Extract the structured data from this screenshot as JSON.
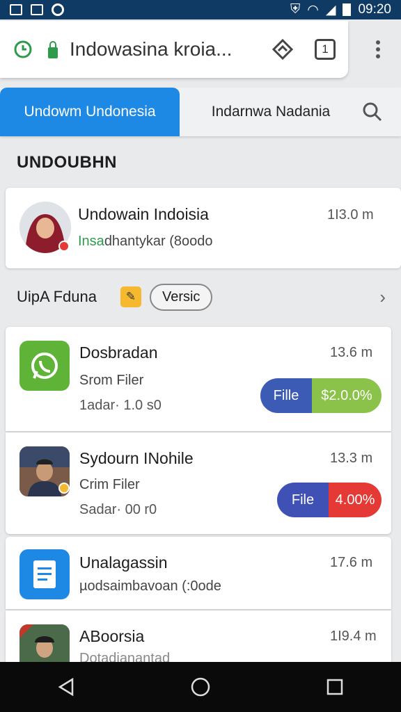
{
  "status_bar": {
    "time": "09:20"
  },
  "browser": {
    "url_text": "Indowasina kroia...",
    "tab_count": "1"
  },
  "tabs": [
    {
      "label": "Undowm Undonesia"
    },
    {
      "label": "Indarnwa Nadania"
    }
  ],
  "section_title": "UNDOUBHN",
  "profile": {
    "name": "Undowain Indoisia",
    "subtitle_green": "Insa",
    "subtitle_rest": "dhantykar (8oodo",
    "time": "1I3.0 m"
  },
  "filter": {
    "label": "UipA Fduna",
    "chip": "Versic"
  },
  "items": [
    {
      "title": "Dosbradan",
      "sub": "Srom Filer",
      "meta": "1adar· 1.0 s0",
      "time": "13.6 m",
      "pill_left": "Fille",
      "pill_right": "$2.0.0%",
      "pill_left_color": "#3b5bb5",
      "pill_right_color": "#8bc34a"
    },
    {
      "title": "Sydourn INohile",
      "sub": "Crim Filer",
      "meta": "Sadar· 00 r0",
      "time": "13.3 m",
      "pill_left": "File",
      "pill_right": "4.00%",
      "pill_left_color": "#3f51b5",
      "pill_right_color": "#e53935"
    },
    {
      "title": "Unalagassin",
      "sub": "µodsaimbavoan (:0ode",
      "time": "17.6 m"
    },
    {
      "title": "ABoorsia",
      "sub": "Dotadianantad",
      "time": "1I9.4 m"
    }
  ],
  "colors": {
    "accent": "#1e88e5",
    "status_bar": "#0e3a63",
    "whatsapp": "#5fb336",
    "docs": "#1e88e5"
  }
}
